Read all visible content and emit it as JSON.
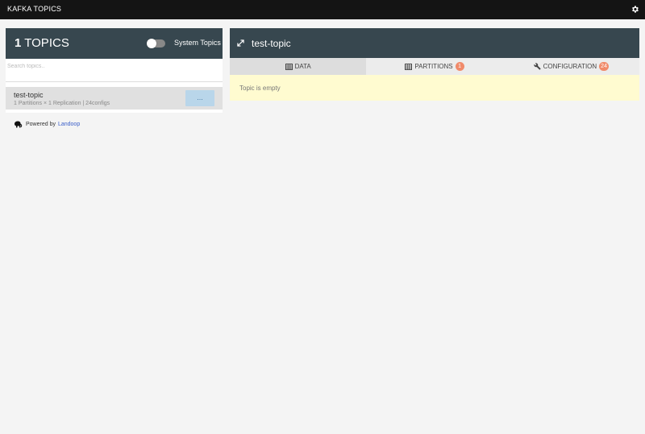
{
  "app": {
    "title": "KAFKA TOPICS"
  },
  "topics_panel": {
    "count": "1",
    "heading": "TOPICS",
    "system_toggle_label": "System Topics",
    "search_placeholder": "Search topics..",
    "items": [
      {
        "name": "test-topic",
        "meta": "1 Partitions × 1 Replication | 24configs",
        "action_label": "..."
      }
    ]
  },
  "footer": {
    "powered_by": "Powered by",
    "brand": "Landoop"
  },
  "topic_view": {
    "title": "test-topic",
    "tabs": [
      {
        "label": "DATA",
        "icon": "table-icon",
        "active": true
      },
      {
        "label": "PARTITIONS",
        "icon": "table-icon",
        "badge": "1"
      },
      {
        "label": "CONFIGURATION",
        "icon": "wrench-icon",
        "badge": "24"
      }
    ],
    "empty_message": "Topic is empty"
  },
  "colors": {
    "topbar": "#141414",
    "panel_header": "#37474f",
    "badge": "#f08a6a",
    "empty_bg": "#fffbd0",
    "link": "#3b5fc9"
  }
}
